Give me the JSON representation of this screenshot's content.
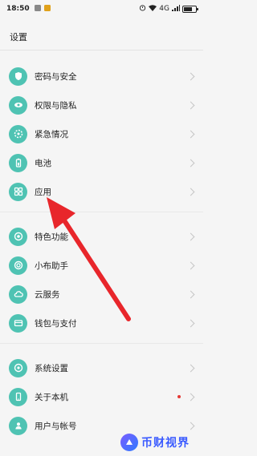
{
  "status_bar": {
    "time": "18:50",
    "right_text": "4G",
    "battery_level": 0.7
  },
  "page_title": "设置",
  "items": [
    {
      "label": "密码与安全",
      "icon": "lock-shield-icon"
    },
    {
      "label": "权限与隐私",
      "icon": "privacy-eye-icon"
    },
    {
      "label": "紧急情况",
      "icon": "emergency-icon"
    },
    {
      "label": "电池",
      "icon": "battery-icon"
    },
    {
      "label": "应用",
      "icon": "apps-grid-icon"
    },
    {
      "label": "特色功能",
      "icon": "feature-icon"
    },
    {
      "label": "小布助手",
      "icon": "assistant-icon"
    },
    {
      "label": "云服务",
      "icon": "cloud-icon"
    },
    {
      "label": "钱包与支付",
      "icon": "wallet-icon"
    },
    {
      "label": "系统设置",
      "icon": "system-settings-icon"
    },
    {
      "label": "关于本机",
      "icon": "phone-icon"
    },
    {
      "label": "用户与帐号",
      "icon": "user-account-icon"
    }
  ],
  "watermark": {
    "text": "币财视界"
  },
  "colors": {
    "icon_bg": "#4fc3b3",
    "arrow": "#e8262b",
    "badge_dot": "#e53935"
  }
}
